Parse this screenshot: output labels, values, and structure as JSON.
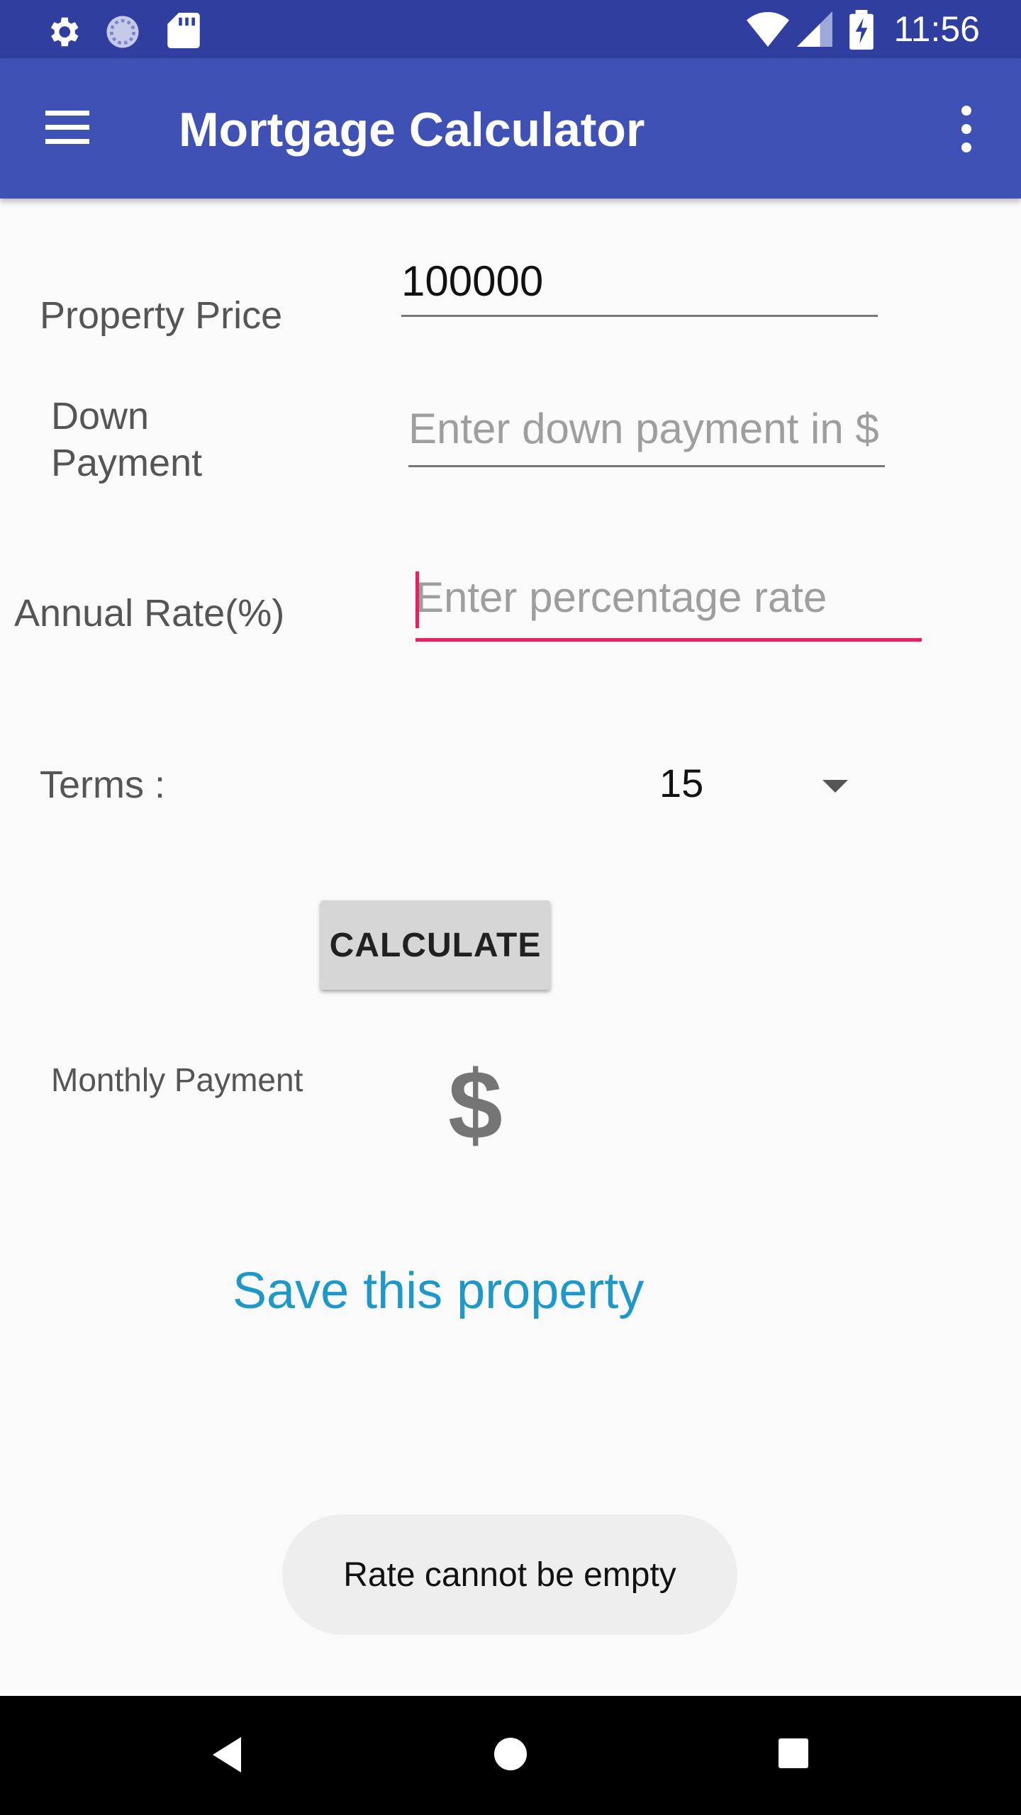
{
  "status_bar": {
    "time": "11:56",
    "left_icons": [
      "gear-icon",
      "sync-icon",
      "sd-card-icon"
    ],
    "right_icons": [
      "wifi-icon",
      "cell-signal-icon",
      "battery-charging-icon"
    ],
    "background": "#303f9f"
  },
  "toolbar": {
    "title": "Mortgage Calculator",
    "background": "#3f51b5"
  },
  "form": {
    "property_price": {
      "label": "Property Price",
      "value": "100000",
      "placeholder": ""
    },
    "down_payment": {
      "label_line1": "Down",
      "label_line2": "Payment",
      "value": "",
      "placeholder": "Enter down payment in $"
    },
    "annual_rate": {
      "label": "Annual Rate(%)",
      "value": "",
      "placeholder": "Enter percentage rate",
      "focused": true
    },
    "terms": {
      "label": "Terms :",
      "selected": "15"
    }
  },
  "calculate_button": {
    "label": "CALCULATE"
  },
  "result": {
    "label": "Monthly Payment",
    "value": "$"
  },
  "save_link": {
    "label": "Save this property",
    "color": "#1e98c9"
  },
  "toast": {
    "message": "Rate cannot be empty"
  },
  "accent_color": "#e91e63"
}
